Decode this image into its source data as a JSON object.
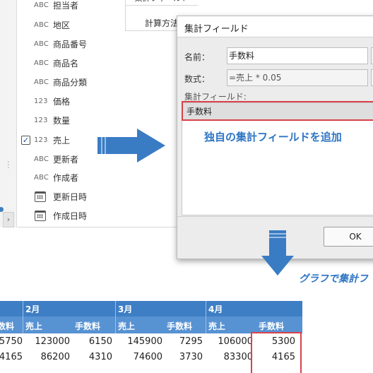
{
  "field_list": {
    "items": [
      {
        "type": "ABC",
        "label": "担当者",
        "checked": false,
        "icon": "text-type"
      },
      {
        "type": "ABC",
        "label": "地区",
        "checked": false,
        "icon": "text-type"
      },
      {
        "type": "ABC",
        "label": "商品番号",
        "checked": false,
        "icon": "text-type"
      },
      {
        "type": "ABC",
        "label": "商品名",
        "checked": false,
        "icon": "text-type"
      },
      {
        "type": "ABC",
        "label": "商品分類",
        "checked": false,
        "icon": "text-type"
      },
      {
        "type": "123",
        "label": "価格",
        "checked": false,
        "icon": "number-type"
      },
      {
        "type": "123",
        "label": "数量",
        "checked": false,
        "icon": "number-type"
      },
      {
        "type": "123",
        "label": "売上",
        "checked": true,
        "icon": "number-type"
      },
      {
        "type": "ABC",
        "label": "更新者",
        "checked": false,
        "icon": "text-type"
      },
      {
        "type": "ABC",
        "label": "作成者",
        "checked": false,
        "icon": "text-type"
      },
      {
        "type": "",
        "label": "更新日時",
        "checked": false,
        "icon": "calendar-icon"
      },
      {
        "type": "",
        "label": "作成日時",
        "checked": false,
        "icon": "calendar-icon"
      }
    ],
    "check_mark": "✓"
  },
  "side_buttons": {
    "calc_field": "集計フィールド",
    "calc_method": "計算方法"
  },
  "dialog": {
    "title": "集計フィールド",
    "name_label": "名前：",
    "name_value": "手数料",
    "formula_label": "数式：",
    "formula_value": "=売上 * 0.05",
    "list_label": "集計フィールド:",
    "list_items": [
      "手数料"
    ],
    "ok_label": "OK"
  },
  "annotations": {
    "add_calc_field": "独自の集計フィールドを追加",
    "graph_calc": "グラフで集計フ"
  },
  "table": {
    "months": [
      "2月",
      "3月",
      "4月"
    ],
    "first_col_header_partial": "数料",
    "sub_headers": [
      "売上",
      "手数料",
      "売上",
      "手数料",
      "売上",
      "手数料"
    ],
    "rows": [
      {
        "first": "5750",
        "cells": [
          "123000",
          "6150",
          "145900",
          "7295",
          "106000",
          "5300"
        ]
      },
      {
        "first": "4165",
        "cells": [
          "86200",
          "4310",
          "74600",
          "3730",
          "83300",
          "4165"
        ]
      }
    ]
  },
  "colors": {
    "accent_blue": "#2e75c4",
    "header_blue": "#3e7ec4",
    "subheader_blue": "#5792d3",
    "highlight_red": "#d9424a"
  }
}
